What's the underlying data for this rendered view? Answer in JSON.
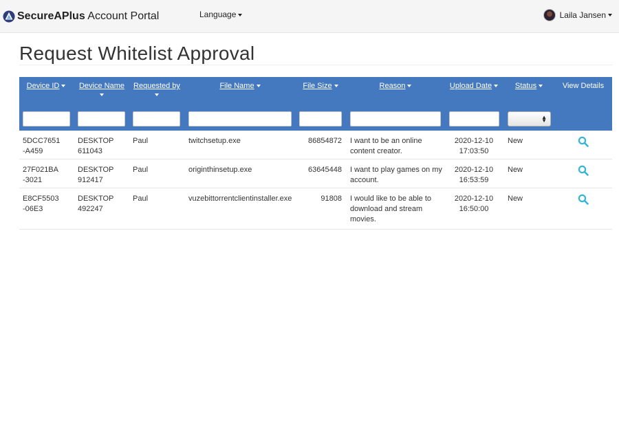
{
  "navbar": {
    "brand_bold_1": "Secure",
    "brand_bold_2": "APlus",
    "brand_rest": " Account Portal",
    "language_label": "Language",
    "user_name": "Laila Jansen"
  },
  "page": {
    "title": "Request Whitelist Approval"
  },
  "table": {
    "header_color": "#4479c0",
    "columns": {
      "device_id": "Device ID",
      "device_name": "Device Name",
      "requested_by": "Requested by",
      "file_name": "File Name",
      "file_size": "File Size",
      "reason": "Reason",
      "upload_date": "Upload Date",
      "status": "Status",
      "view_details": "View Details"
    },
    "rows": [
      {
        "device_id": [
          "5DCC7651",
          "-A459"
        ],
        "device_name": [
          "DESKTOP",
          "611043"
        ],
        "requested_by": "Paul",
        "file_name": "twitchsetup.exe",
        "file_size": "86854872",
        "reason": [
          "I want to be an online",
          "content creator."
        ],
        "upload_date": [
          "2020-12-10",
          "17:03:50"
        ],
        "status": "New",
        "view_icon": "search-icon"
      },
      {
        "device_id": [
          "27F021BA",
          "-3021"
        ],
        "device_name": [
          "DESKTOP",
          "912417"
        ],
        "requested_by": "Paul",
        "file_name": "originthinsetup.exe",
        "file_size": "63645448",
        "reason": [
          "I want to play games on my",
          "account."
        ],
        "upload_date": [
          "2020-12-10",
          "16:53:59"
        ],
        "status": "New",
        "view_icon": "search-icon"
      },
      {
        "device_id": [
          "E8CF5503",
          "-06E3"
        ],
        "device_name": [
          "DESKTOP",
          "492247"
        ],
        "requested_by": "Paul",
        "file_name": "vuzebittorrentclientinstaller.exe",
        "file_size": "91808",
        "reason": [
          "I would like to be able to",
          "download and stream",
          "movies."
        ],
        "upload_date": [
          "2020-12-10",
          "16:50:00"
        ],
        "status": "New",
        "view_icon": "search-icon"
      }
    ]
  }
}
